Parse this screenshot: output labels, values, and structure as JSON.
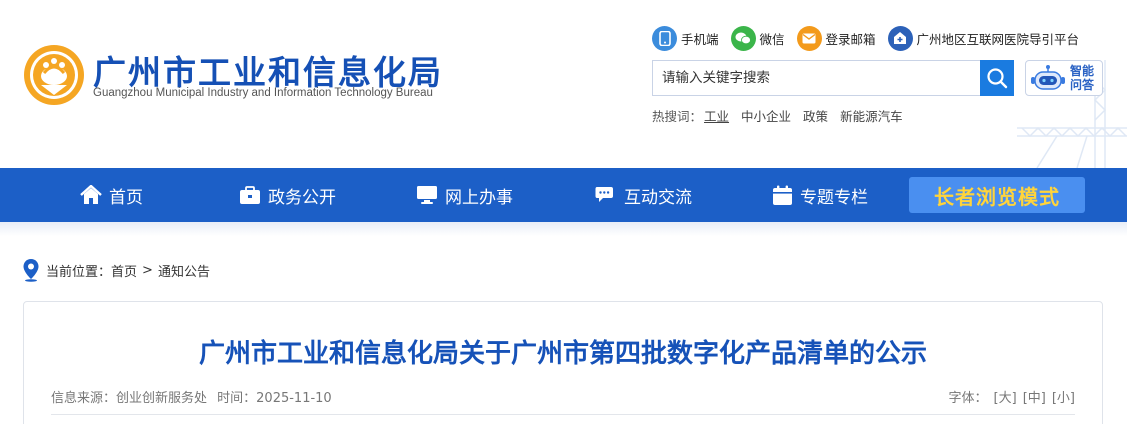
{
  "header": {
    "title": "广州市工业和信息化局",
    "subtitle": "Guangzhou Municipal Industry and Information Technology Bureau",
    "quick_links": [
      {
        "label": "手机端",
        "icon": "mobile-icon"
      },
      {
        "label": "微信",
        "icon": "wechat-icon"
      },
      {
        "label": "登录邮箱",
        "icon": "mail-icon"
      },
      {
        "label": "广州地区互联网医院导引平台",
        "icon": "hospital-icon"
      }
    ],
    "search_placeholder": "请输入关键字搜索",
    "robot_label_1": "智能",
    "robot_label_2": "问答",
    "hot_label": "热搜词：",
    "hot_words": [
      "工业",
      "中小企业",
      "政策",
      "新能源汽车"
    ]
  },
  "nav": {
    "items": [
      {
        "label": "首页",
        "icon": "home-icon"
      },
      {
        "label": "政务公开",
        "icon": "briefcase-icon"
      },
      {
        "label": "网上办事",
        "icon": "monitor-icon"
      },
      {
        "label": "互动交流",
        "icon": "chat-icon"
      },
      {
        "label": "专题专栏",
        "icon": "calendar-icon"
      }
    ],
    "elder_mode": "长者浏览模式"
  },
  "breadcrumb": {
    "label": "当前位置：",
    "items": [
      "首页",
      "通知公告"
    ],
    "separator": ">"
  },
  "article": {
    "title": "广州市工业和信息化局关于广州市第四批数字化产品清单的公示",
    "source": "信息来源：创业创新服务处",
    "time": "时间：2025-11-10",
    "font_label": "字体：",
    "font_sizes": [
      "[大]",
      "[中]",
      "[小]"
    ]
  },
  "colors": {
    "brand_blue": "#1c5fc7",
    "title_blue": "#1652b8",
    "elder_text": "#ffd43b"
  }
}
